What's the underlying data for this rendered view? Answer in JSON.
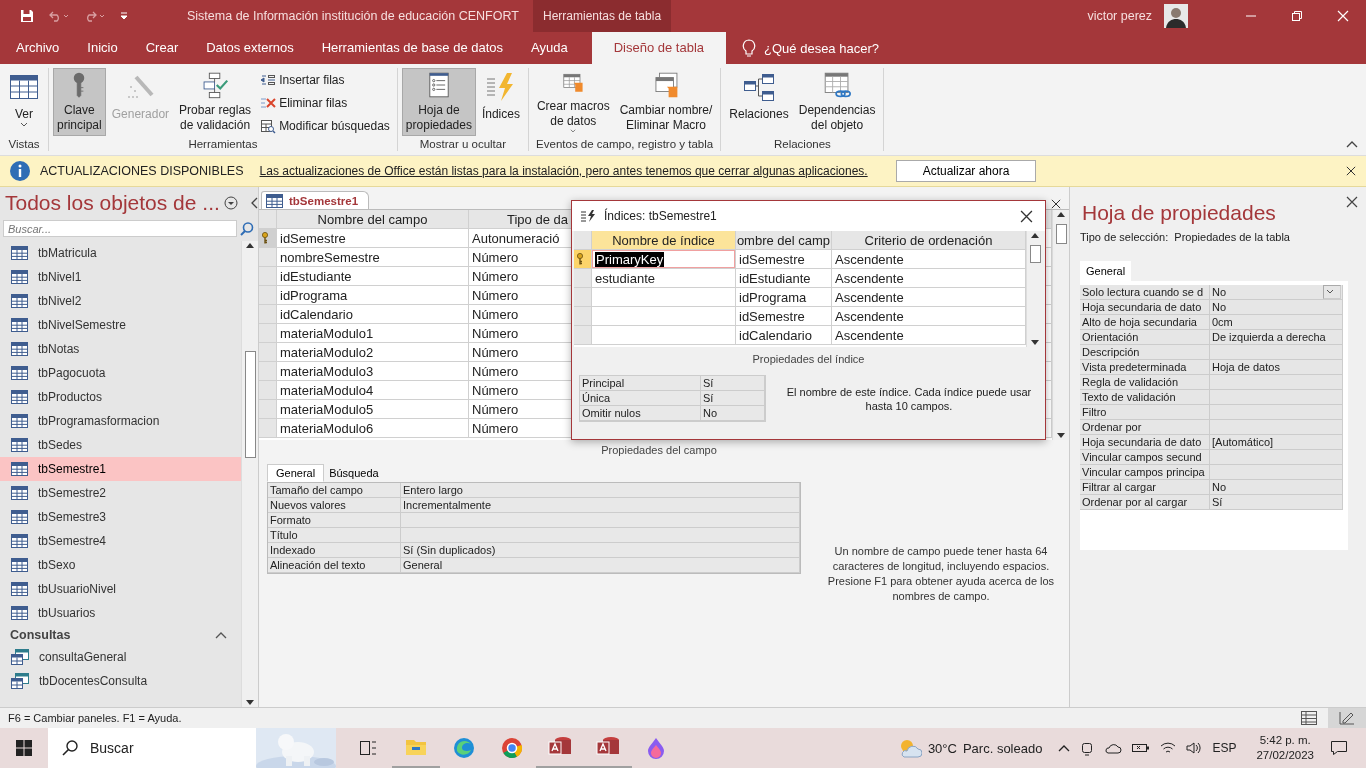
{
  "title_bar": {
    "title": "Sistema de Información institución de educación CENFORT",
    "context_tab": "Herramientas de tabla",
    "user": "victor perez"
  },
  "menu_tabs": [
    {
      "label": "Archivo",
      "selected": false
    },
    {
      "label": "Inicio",
      "selected": false
    },
    {
      "label": "Crear",
      "selected": false
    },
    {
      "label": "Datos externos",
      "selected": false
    },
    {
      "label": "Herramientas de base de datos",
      "selected": false
    },
    {
      "label": "Ayuda",
      "selected": false
    },
    {
      "label": "Diseño de tabla",
      "selected": true
    }
  ],
  "tell_me": "¿Qué desea hacer?",
  "ribbon": {
    "groups": [
      {
        "label": "Vistas",
        "buttons": [
          {
            "label": "Ver",
            "kind": "large",
            "caret": true,
            "pressed": false,
            "disabled": false
          }
        ]
      },
      {
        "label": "Herramientas",
        "buttons": [
          {
            "label": "Clave\nprincipal",
            "kind": "large",
            "caret": false,
            "pressed": true,
            "disabled": false
          },
          {
            "label": "Generador",
            "kind": "large",
            "caret": false,
            "pressed": false,
            "disabled": true
          },
          {
            "label": "Probar reglas\nde validación",
            "kind": "large",
            "caret": false,
            "pressed": false,
            "disabled": false
          },
          {
            "label": "Insertar filas",
            "kind": "small",
            "caret": false,
            "pressed": false,
            "disabled": false
          },
          {
            "label": "Eliminar filas",
            "kind": "small",
            "caret": false,
            "pressed": false,
            "disabled": false
          },
          {
            "label": "Modificar búsquedas",
            "kind": "small",
            "caret": false,
            "pressed": false,
            "disabled": false
          }
        ]
      },
      {
        "label": "Mostrar u ocultar",
        "buttons": [
          {
            "label": "Hoja de\npropiedades",
            "kind": "large",
            "caret": false,
            "pressed": true,
            "disabled": false
          },
          {
            "label": "Índices",
            "kind": "large",
            "caret": false,
            "pressed": false,
            "disabled": false
          }
        ]
      },
      {
        "label": "Eventos de campo, registro y tabla",
        "buttons": [
          {
            "label": "Crear macros\nde datos",
            "kind": "large",
            "caret": true,
            "pressed": false,
            "disabled": false
          },
          {
            "label": "Cambiar nombre/\nEliminar Macro",
            "kind": "large",
            "caret": false,
            "pressed": false,
            "disabled": false
          }
        ]
      },
      {
        "label": "Relaciones",
        "buttons": [
          {
            "label": "Relaciones",
            "kind": "large",
            "caret": false,
            "pressed": false,
            "disabled": false
          },
          {
            "label": "Dependencias\ndel objeto",
            "kind": "large",
            "caret": false,
            "pressed": false,
            "disabled": false
          }
        ]
      }
    ]
  },
  "message_bar": {
    "title": "ACTUALIZACIONES DISPONIBLES",
    "text": "Las actualizaciones de Office están listas para la instalación, pero antes tenemos que cerrar algunas aplicaciones.",
    "button": "Actualizar ahora"
  },
  "nav": {
    "title": "Todos los objetos de ...",
    "search_placeholder": "Buscar...",
    "items": [
      {
        "label": "tbMatricula",
        "kind": "table",
        "selected": false
      },
      {
        "label": "tbNivel1",
        "kind": "table",
        "selected": false
      },
      {
        "label": "tbNivel2",
        "kind": "table",
        "selected": false
      },
      {
        "label": "tbNivelSemestre",
        "kind": "table",
        "selected": false
      },
      {
        "label": "tbNotas",
        "kind": "table",
        "selected": false
      },
      {
        "label": "tbPagocuota",
        "kind": "table",
        "selected": false
      },
      {
        "label": "tbProductos",
        "kind": "table",
        "selected": false
      },
      {
        "label": "tbProgramasformacion",
        "kind": "table",
        "selected": false
      },
      {
        "label": "tbSedes",
        "kind": "table",
        "selected": false
      },
      {
        "label": "tbSemestre1",
        "kind": "table",
        "selected": true
      },
      {
        "label": "tbSemestre2",
        "kind": "table",
        "selected": false
      },
      {
        "label": "tbSemestre3",
        "kind": "table",
        "selected": false
      },
      {
        "label": "tbSemestre4",
        "kind": "table",
        "selected": false
      },
      {
        "label": "tbSexo",
        "kind": "table",
        "selected": false
      },
      {
        "label": "tbUsuarioNivel",
        "kind": "table",
        "selected": false
      },
      {
        "label": "tbUsuarios",
        "kind": "table",
        "selected": false
      }
    ],
    "sections": [
      {
        "title": "Consultas",
        "items": [
          {
            "label": "consultaGeneral",
            "kind": "query",
            "selected": false
          },
          {
            "label": "tbDocentesConsulta",
            "kind": "query",
            "selected": false
          }
        ]
      }
    ]
  },
  "document": {
    "tab": "tbSemestre1",
    "columns": [
      "Nombre del campo",
      "Tipo de da"
    ],
    "rows": [
      {
        "name": "idSemestre",
        "type": "Autonumeració",
        "primary_key": true
      },
      {
        "name": "nombreSemestre",
        "type": "Número",
        "primary_key": false
      },
      {
        "name": "idEstudiante",
        "type": "Número",
        "primary_key": false
      },
      {
        "name": "idPrograma",
        "type": "Número",
        "primary_key": false
      },
      {
        "name": "idCalendario",
        "type": "Número",
        "primary_key": false
      },
      {
        "name": "materiaModulo1",
        "type": "Número",
        "primary_key": false
      },
      {
        "name": "materiaModulo2",
        "type": "Número",
        "primary_key": false
      },
      {
        "name": "materiaModulo3",
        "type": "Número",
        "primary_key": false
      },
      {
        "name": "materiaModulo4",
        "type": "Número",
        "primary_key": false
      },
      {
        "name": "materiaModulo5",
        "type": "Número",
        "primary_key": false
      },
      {
        "name": "materiaModulo6",
        "type": "Número",
        "primary_key": false
      }
    ],
    "field_properties": {
      "title": "Propiedades del campo",
      "tabs": [
        {
          "label": "General",
          "selected": true
        },
        {
          "label": "Búsqueda",
          "selected": false
        }
      ],
      "rows": [
        {
          "label": "Tamaño del campo",
          "value": "Entero largo"
        },
        {
          "label": "Nuevos valores",
          "value": "Incrementalmente"
        },
        {
          "label": "Formato"
        },
        {
          "label": "Título"
        },
        {
          "label": "Indexado",
          "value": "Sí (Sin duplicados)"
        },
        {
          "label": "Alineación del texto",
          "value": "General"
        }
      ],
      "help": "Un nombre de campo puede tener hasta 64 caracteres de longitud, incluyendo espacios. Presione F1 para obtener ayuda acerca de los nombres de campo."
    }
  },
  "index_dialog": {
    "title": "Índices: tbSemestre1",
    "columns": [
      "Nombre de índice",
      "ombre del camp",
      "Criterio de ordenación"
    ],
    "rows": [
      {
        "index_name": "PrimaryKey",
        "field": "idSemestre",
        "order": "Ascendente",
        "primary_key": true,
        "selected": true
      },
      {
        "index_name": "estudiante",
        "field": "idEstudiante",
        "order": "Ascendente",
        "primary_key": false,
        "selected": false
      },
      {
        "field": "idPrograma",
        "order": "Ascendente",
        "primary_key": false,
        "selected": false
      },
      {
        "field": "idSemestre",
        "order": "Ascendente",
        "primary_key": false,
        "selected": false
      },
      {
        "field": "idCalendario",
        "order": "Ascendente",
        "primary_key": false,
        "selected": false
      }
    ],
    "properties_title": "Propiedades del índice",
    "properties": [
      {
        "label": "Principal",
        "value": "Sí"
      },
      {
        "label": "Única",
        "value": "Sí"
      },
      {
        "label": "Omitir nulos",
        "value": "No"
      }
    ],
    "help": "El nombre de este índice. Cada índice puede usar hasta 10 campos."
  },
  "property_sheet": {
    "title": "Hoja de propiedades",
    "selection_label": "Tipo de selección:",
    "selection": "Propiedades de la tabla",
    "tab": "General",
    "rows": [
      {
        "label": "Solo lectura cuando se d",
        "value": "No",
        "dropdown": true
      },
      {
        "label": "Hoja secundaria de dato",
        "value": "No",
        "dropdown": false
      },
      {
        "label": "Alto de hoja secundaria",
        "value": "0cm",
        "dropdown": false
      },
      {
        "label": "Orientación",
        "value": "De izquierda a derecha",
        "dropdown": false
      },
      {
        "label": "Descripción",
        "dropdown": false
      },
      {
        "label": "Vista predeterminada",
        "value": "Hoja de datos",
        "dropdown": false
      },
      {
        "label": "Regla de validación",
        "dropdown": false
      },
      {
        "label": "Texto de validación",
        "dropdown": false
      },
      {
        "label": "Filtro",
        "dropdown": false
      },
      {
        "label": "Ordenar por",
        "dropdown": false
      },
      {
        "label": "Hoja secundaria de dato",
        "value": "[Automático]",
        "dropdown": false
      },
      {
        "label": "Vincular campos secund",
        "dropdown": false
      },
      {
        "label": "Vincular campos principa",
        "dropdown": false
      },
      {
        "label": "Filtrar al cargar",
        "value": "No",
        "dropdown": false
      },
      {
        "label": "Ordenar por al cargar",
        "value": "Sí",
        "dropdown": false
      }
    ]
  },
  "status_bar": {
    "text": "F6 = Cambiar paneles.  F1 = Ayuda.",
    "views": [
      {
        "selected": false
      },
      {
        "selected": true
      }
    ]
  },
  "taskbar": {
    "search": "Buscar",
    "temperature": "30°C",
    "weather": "Parc. soleado",
    "language": "ESP",
    "time": "5:42 p. m.",
    "date": "27/02/2023"
  }
}
